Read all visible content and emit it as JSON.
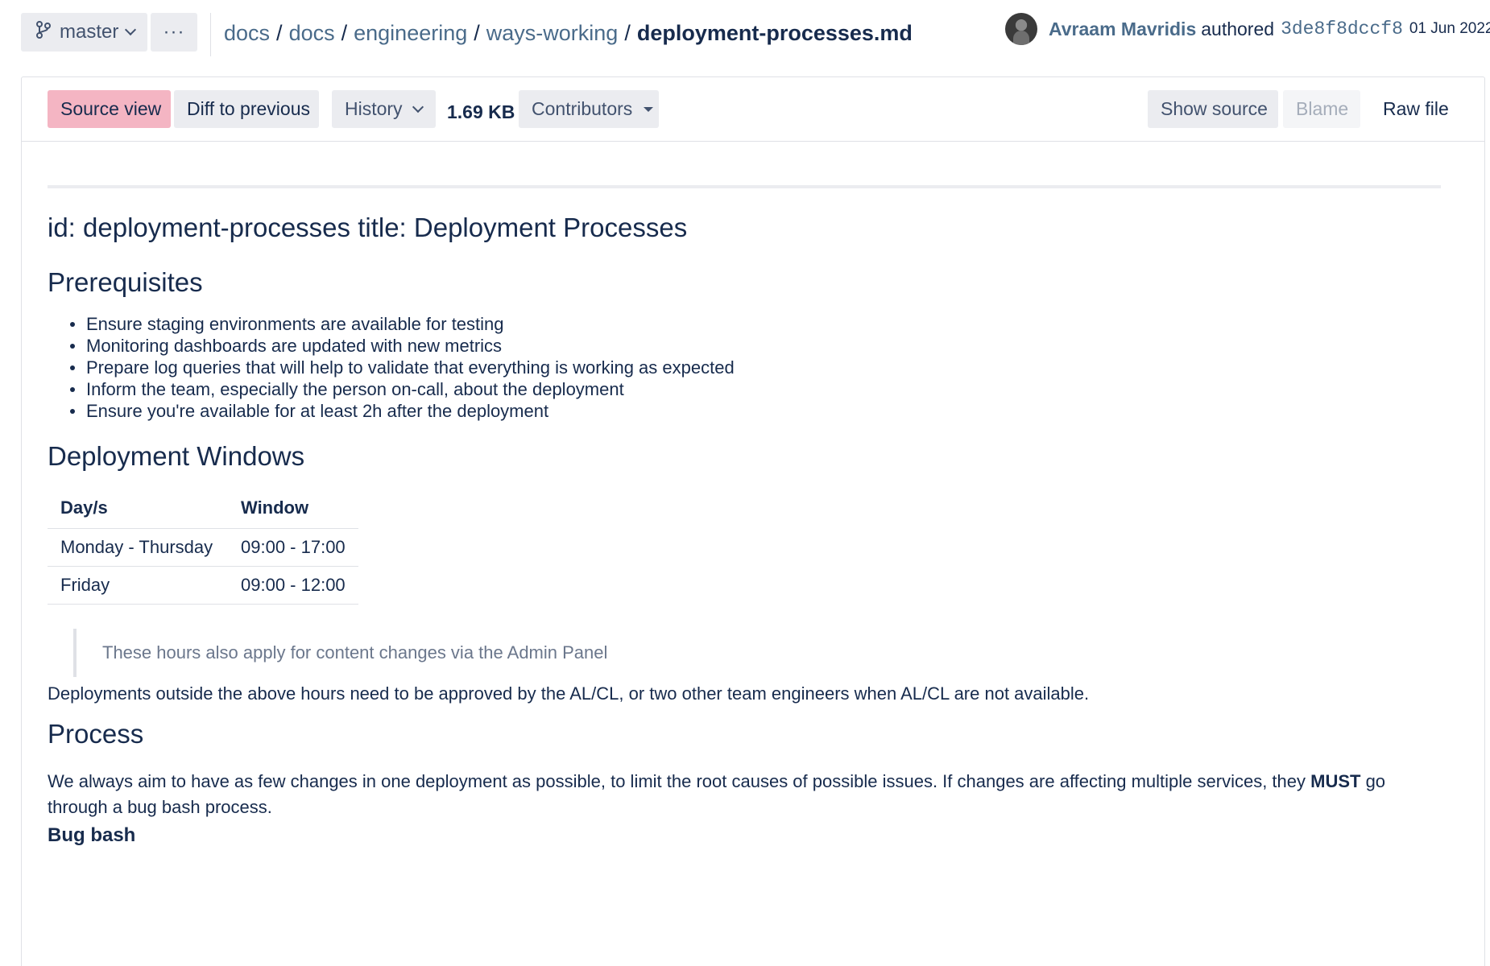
{
  "topbar": {
    "branch": "master",
    "more": "···",
    "breadcrumb": {
      "items": [
        "docs",
        "docs",
        "engineering",
        "ways-working"
      ],
      "separator": "/",
      "current": "deployment-processes.md"
    },
    "commit": {
      "author": "Avraam Mavridis",
      "verb": "authored",
      "hash": "3de8f8dccf8",
      "date": "01 Jun 2022"
    }
  },
  "toolbar": {
    "source_view": "Source view",
    "diff_to_previous": "Diff to previous",
    "history": "History",
    "size": "1.69 KB",
    "contributors": "Contributors",
    "show_source": "Show source",
    "blame": "Blame",
    "raw_file": "Raw file",
    "accent_color": "#f4b5c3"
  },
  "content": {
    "front_matter": "id: deployment-processes title: Deployment Processes",
    "prerequisites": {
      "heading": "Prerequisites",
      "items": [
        "Ensure staging environments are available for testing",
        "Monitoring dashboards are updated with new metrics",
        "Prepare log queries that will help to validate that everything is working as expected",
        "Inform the team, especially the person on-call, about the deployment",
        "Ensure you're available for at least 2h after the deployment"
      ]
    },
    "windows": {
      "heading": "Deployment Windows",
      "columns": [
        "Day/s",
        "Window"
      ],
      "rows": [
        [
          "Monday - Thursday",
          "09:00 - 17:00"
        ],
        [
          "Friday",
          "09:00 - 12:00"
        ]
      ],
      "quote": "These hours also apply for content changes via the Admin Panel",
      "note": "Deployments outside the above hours need to be approved by the AL/CL, or two other team engineers when AL/CL are not available."
    },
    "process": {
      "heading": "Process",
      "text_before": "We always aim to have as few changes in one deployment as possible, to limit the root causes of possible issues. If changes are affecting multiple services, they ",
      "text_strong": "MUST",
      "text_after": " go through a bug bash process.",
      "subheading": "Bug bash"
    }
  }
}
